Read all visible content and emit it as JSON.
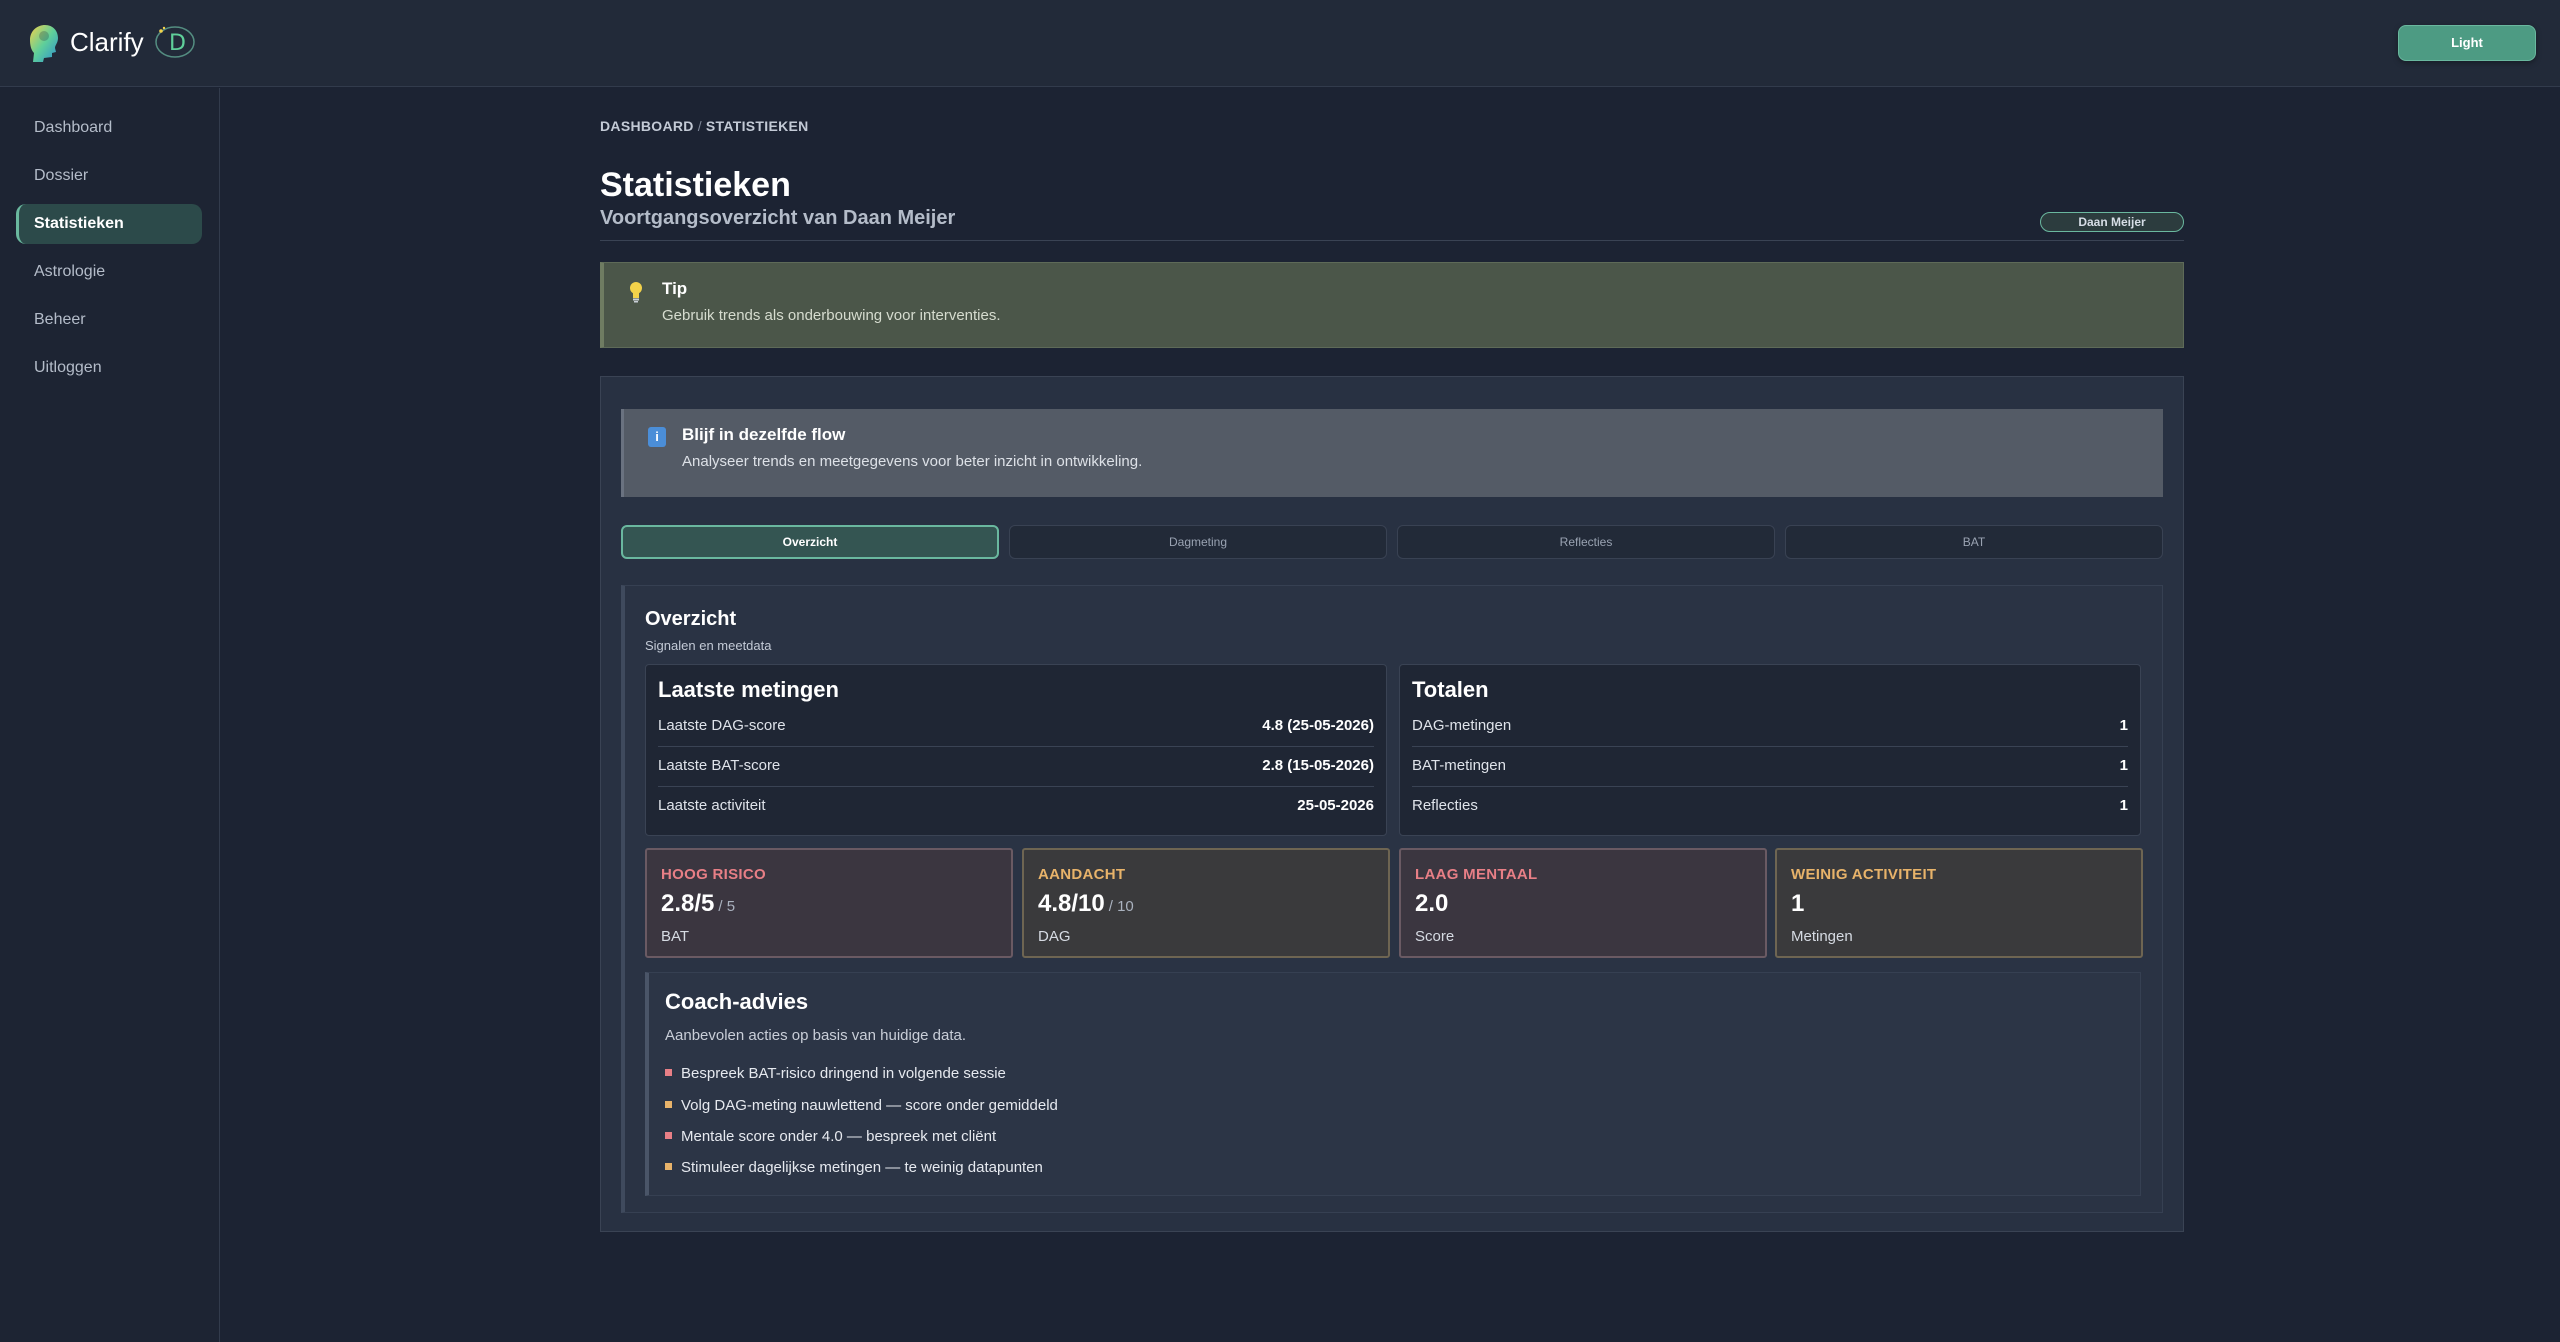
{
  "app": {
    "name": "Clarify",
    "badge_letter": "D"
  },
  "header": {
    "theme_button": "Light"
  },
  "sidebar": {
    "items": [
      {
        "label": "Dashboard",
        "active": false
      },
      {
        "label": "Dossier",
        "active": false
      },
      {
        "label": "Statistieken",
        "active": true
      },
      {
        "label": "Astrologie",
        "active": false
      },
      {
        "label": "Beheer",
        "active": false
      },
      {
        "label": "Uitloggen",
        "active": false
      }
    ]
  },
  "breadcrumb": {
    "home": "DASHBOARD",
    "separator": "/",
    "current": "STATISTIEKEN"
  },
  "page": {
    "title": "Statistieken",
    "subtitle": "Voortgangsoverzicht van Daan Meijer",
    "user_pill": "Daan Meijer"
  },
  "tip": {
    "title": "Tip",
    "text": "Gebruik trends als onderbouwing voor interventies."
  },
  "info": {
    "title": "Blijf in dezelfde flow",
    "text": "Analyseer trends en meetgegevens voor beter inzicht in ontwikkeling."
  },
  "tabs": [
    {
      "label": "Overzicht",
      "active": true
    },
    {
      "label": "Dagmeting",
      "active": false
    },
    {
      "label": "Reflecties",
      "active": false
    },
    {
      "label": "BAT",
      "active": false
    }
  ],
  "overview": {
    "title": "Overzicht",
    "subtitle": "Signalen en meetdata",
    "latest": {
      "title": "Laatste metingen",
      "rows": [
        {
          "label": "Laatste DAG-score",
          "value": "4.8 (25-05-2026)"
        },
        {
          "label": "Laatste BAT-score",
          "value": "2.8 (15-05-2026)"
        },
        {
          "label": "Laatste activiteit",
          "value": "25-05-2026"
        }
      ]
    },
    "totals": {
      "title": "Totalen",
      "rows": [
        {
          "label": "DAG-metingen",
          "value": "1"
        },
        {
          "label": "BAT-metingen",
          "value": "1"
        },
        {
          "label": "Reflecties",
          "value": "1"
        }
      ]
    },
    "metrics": [
      {
        "label": "HOOG RISICO",
        "value": "2.8/5",
        "max": "/ 5",
        "note": "BAT",
        "tone": "red"
      },
      {
        "label": "AANDACHT",
        "value": "4.8/10",
        "max": "/ 10",
        "note": "DAG",
        "tone": "amber"
      },
      {
        "label": "LAAG MENTAAL",
        "value": "2.0",
        "max": "",
        "note": "Score",
        "tone": "red"
      },
      {
        "label": "WEINIG ACTIVITEIT",
        "value": "1",
        "max": "",
        "note": "Metingen",
        "tone": "amber"
      }
    ],
    "advice": {
      "title": "Coach-advies",
      "subtitle": "Aanbevolen acties op basis van huidige data.",
      "items": [
        {
          "text": "Bespreek BAT-risico dringend in volgende sessie",
          "color": "#e87f86"
        },
        {
          "text": "Volg DAG-meting nauwlettend — score onder gemiddeld",
          "color": "#e8b36a"
        },
        {
          "text": "Mentale score onder 4.0 — bespreek met cliënt",
          "color": "#e87f86"
        },
        {
          "text": "Stimuleer dagelijkse metingen — te weinig datapunten",
          "color": "#e8b36a"
        }
      ]
    }
  },
  "colors": {
    "accent": "#6ab89f",
    "danger": "#e87f86",
    "warning": "#e8b36a",
    "background": "#1c2333"
  }
}
